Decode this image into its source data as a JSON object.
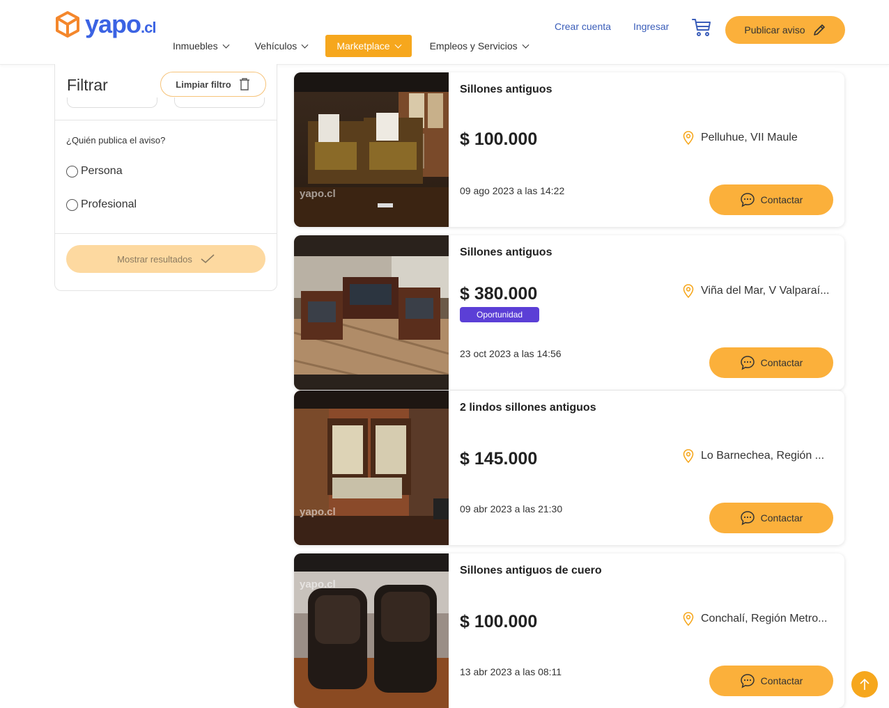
{
  "header": {
    "logo_text": "yapo",
    "logo_suffix": ".cl",
    "nav": [
      {
        "label": "Inmuebles"
      },
      {
        "label": "Vehículos"
      },
      {
        "label": "Marketplace"
      },
      {
        "label": "Empleos y Servicios"
      }
    ],
    "create_account": "Crear cuenta",
    "login": "Ingresar",
    "publish_label": "Publicar aviso"
  },
  "filter": {
    "title": "Filtrar",
    "clear_label": "Limpiar filtro",
    "who_label": "¿Quién publica el aviso?",
    "options": [
      {
        "label": "Persona"
      },
      {
        "label": "Profesional"
      }
    ],
    "show_results": "Mostrar resultados"
  },
  "listings": [
    {
      "title": "Sillones antiguos",
      "price": "$ 100.000",
      "location": "Pelluhue, VII Maule",
      "date": "09 ago 2023 a las 14:22",
      "contact": "Contactar",
      "watermark": "yapo.cl"
    },
    {
      "title": "Sillones antiguos",
      "price": "$ 380.000",
      "badge": "Oportunidad",
      "location": "Viña del Mar, V Valparaí...",
      "date": "23 oct 2023 a las 14:56",
      "contact": "Contactar"
    },
    {
      "title": "2 lindos sillones antiguos",
      "price": "$ 145.000",
      "location": "Lo Barnechea, Región ...",
      "date": "09 abr 2023 a las 21:30",
      "contact": "Contactar",
      "watermark": "yapo.cl"
    },
    {
      "title": "Sillones antiguos de cuero",
      "price": "$ 100.000",
      "location": "Conchalí, Región Metro...",
      "date": "13 abr 2023 a las 08:11",
      "contact": "Contactar",
      "watermark": "yapo.cl"
    }
  ],
  "colors": {
    "accent": "#fbb03b",
    "brand_blue": "#3b63e3",
    "badge": "#5b3fd6"
  }
}
